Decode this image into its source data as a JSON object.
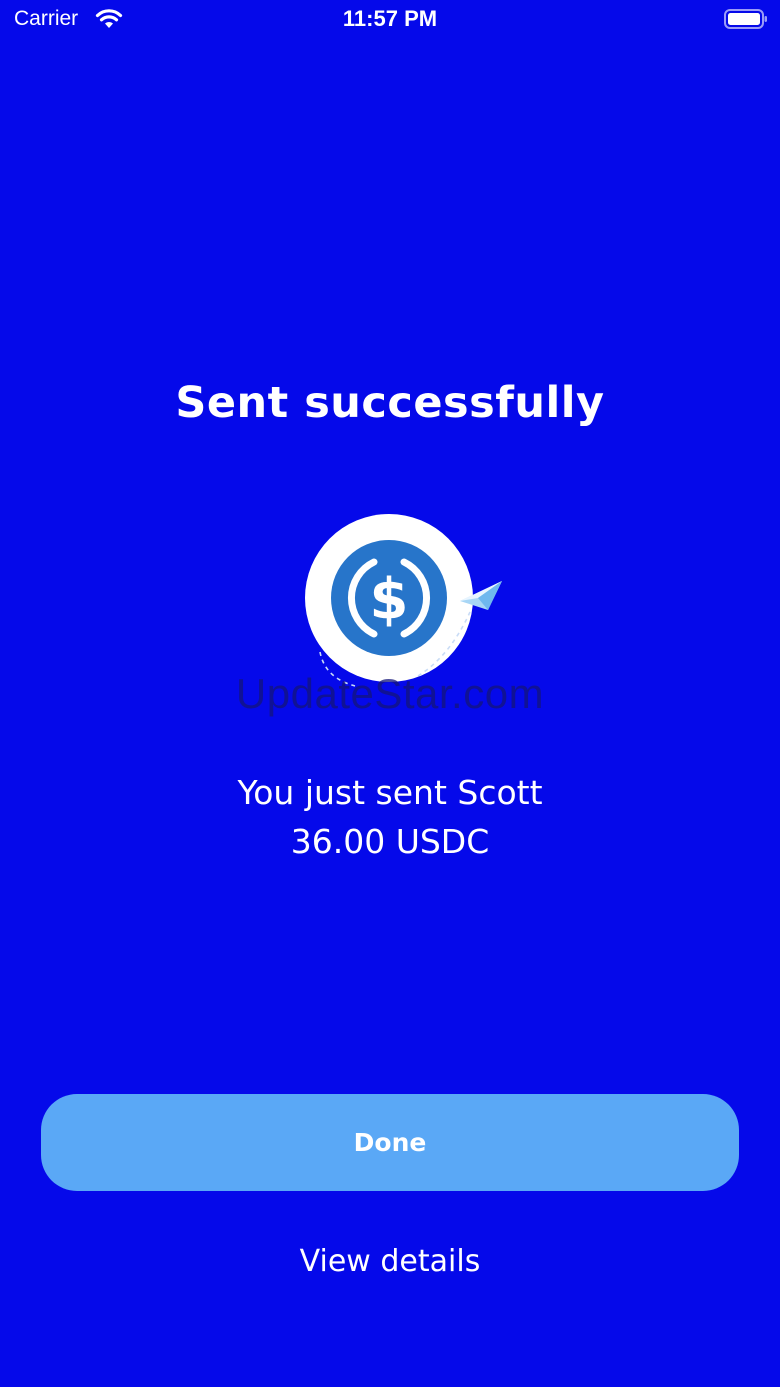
{
  "status_bar": {
    "carrier": "Carrier",
    "time": "11:57 PM",
    "wifi_icon": "wifi-icon",
    "battery_icon": "battery-full-icon"
  },
  "screen": {
    "title": "Sent successfully",
    "illustration_icon": "usdc-coin-icon",
    "plane_icon": "paper-plane-icon",
    "watermark": "UpdateStar.com",
    "message_line1": "You just sent Scott",
    "message_line2": "36.00 USDC"
  },
  "actions": {
    "done_label": "Done",
    "view_details_label": "View details"
  },
  "colors": {
    "background": "#0509ea",
    "button": "#5aa8f6",
    "coin_blue": "#2775ca",
    "text": "#ffffff"
  }
}
